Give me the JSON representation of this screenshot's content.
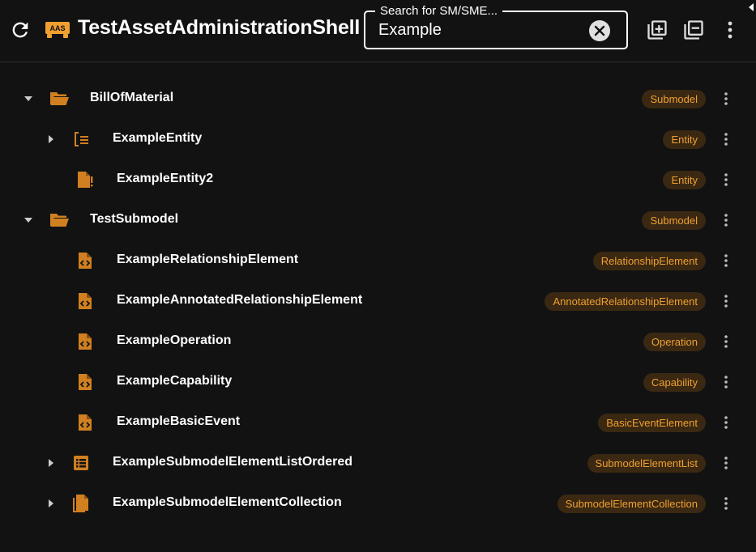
{
  "header": {
    "title": "TestAssetAdministrationShell",
    "logo_text": "AAS",
    "refresh_icon": "refresh-icon",
    "search": {
      "label": "Search for SM/SME...",
      "value": "Example",
      "clear_icon": "close-circle-icon"
    },
    "expand_all_icon": "expand-all-icon",
    "collapse_all_icon": "collapse-all-icon",
    "menu_icon": "more-vert-icon"
  },
  "colors": {
    "background": "#121212",
    "accent": "#d08020",
    "chip_bg": "#3a2812",
    "chip_text": "#f0a030"
  },
  "tree": [
    {
      "label": "BillOfMaterial",
      "type": "Submodel",
      "icon": "folder-open-icon",
      "depth": 0,
      "expander": "expanded"
    },
    {
      "label": "ExampleEntity",
      "type": "Entity",
      "icon": "entity-icon",
      "depth": 1,
      "expander": "collapsed"
    },
    {
      "label": "ExampleEntity2",
      "type": "Entity",
      "icon": "file-alert-icon",
      "depth": 1,
      "expander": "none"
    },
    {
      "label": "TestSubmodel",
      "type": "Submodel",
      "icon": "folder-open-icon",
      "depth": 0,
      "expander": "expanded"
    },
    {
      "label": "ExampleRelationshipElement",
      "type": "RelationshipElement",
      "icon": "file-code-icon",
      "depth": 1,
      "expander": "none"
    },
    {
      "label": "ExampleAnnotatedRelationshipElement",
      "type": "AnnotatedRelationshipElement",
      "icon": "file-code-icon",
      "depth": 1,
      "expander": "none"
    },
    {
      "label": "ExampleOperation",
      "type": "Operation",
      "icon": "file-code-icon",
      "depth": 1,
      "expander": "none"
    },
    {
      "label": "ExampleCapability",
      "type": "Capability",
      "icon": "file-code-icon",
      "depth": 1,
      "expander": "none"
    },
    {
      "label": "ExampleBasicEvent",
      "type": "BasicEventElement",
      "icon": "file-code-icon",
      "depth": 1,
      "expander": "none"
    },
    {
      "label": "ExampleSubmodelElementListOrdered",
      "type": "SubmodelElementList",
      "icon": "list-box-icon",
      "depth": 1,
      "expander": "collapsed"
    },
    {
      "label": "ExampleSubmodelElementCollection",
      "type": "SubmodelElementCollection",
      "icon": "file-multiple-icon",
      "depth": 1,
      "expander": "collapsed"
    }
  ]
}
